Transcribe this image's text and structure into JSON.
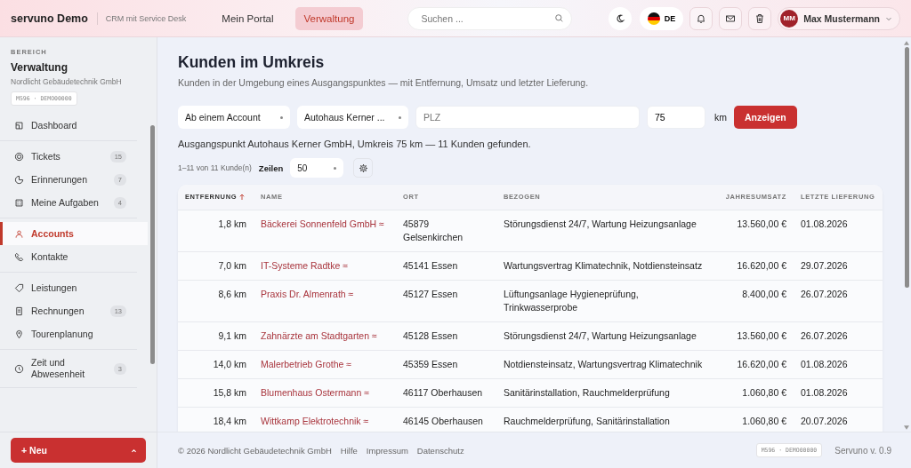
{
  "header": {
    "brand": "servuno Demo",
    "tagline": "CRM mit Service Desk",
    "nav": [
      {
        "label": "Mein Portal",
        "selected": false
      },
      {
        "label": "Verwaltung",
        "selected": true
      }
    ],
    "search": {
      "placeholder": "Suchen ..."
    },
    "language": "DE",
    "user": {
      "initials": "MM",
      "name": "Max Mustermann"
    }
  },
  "sidebar": {
    "section_label": "BEREICH",
    "title": "Verwaltung",
    "company": "Nordlicht Gebäudetechnik GmbH",
    "code": "M596 · DEMO00000",
    "groups": [
      {
        "items": [
          {
            "label": "Dashboard",
            "selected": false
          }
        ]
      },
      {
        "items": [
          {
            "label": "Tickets",
            "count": "15",
            "selected": false
          },
          {
            "label": "Erinnerungen",
            "count": "7",
            "selected": false
          },
          {
            "label": "Meine Aufgaben",
            "count": "4",
            "selected": false
          }
        ]
      },
      {
        "items": [
          {
            "label": "Accounts",
            "selected": true
          },
          {
            "label": "Kontakte",
            "selected": false
          }
        ]
      },
      {
        "items": [
          {
            "label": "Leistungen",
            "selected": false
          },
          {
            "label": "Rechnungen",
            "count": "13",
            "selected": false
          },
          {
            "label": "Tourenplanung",
            "selected": false
          }
        ]
      },
      {
        "items": [
          {
            "label": "Zeit und Abwesenheit",
            "count": "3",
            "selected": false
          }
        ]
      }
    ],
    "new_button": "+ Neu"
  },
  "page": {
    "title": "Kunden im Umkreis",
    "subtitle": "Kunden in der Umgebung eines Ausgangspunktes — mit Entfernung, Umsatz und letzter Lieferung.",
    "filters": {
      "mode": "Ab einem Account",
      "account": "Autohaus Kerner ...",
      "plz_placeholder": "PLZ",
      "radius": "75",
      "unit": "km",
      "button": "Anzeigen"
    },
    "result": "Ausgangspunkt Autohaus Kerner GmbH, Umkreis 75 km — 11 Kunden gefunden.",
    "pagination": {
      "range": "1–11 von 11 Kunde(n)",
      "rows_label": "Zeilen",
      "rows_value": "50"
    },
    "table": {
      "columns": [
        {
          "label": "ENTFERNUNG",
          "sorted": true
        },
        {
          "label": "NAME",
          "sorted": false
        },
        {
          "label": "ORT",
          "sorted": false
        },
        {
          "label": "BEZOGEN",
          "sorted": false
        },
        {
          "label": "JAHRESUMSATZ",
          "sorted": false
        },
        {
          "label": "LETZTE LIEFERUNG",
          "sorted": false
        }
      ],
      "rows": [
        {
          "distance": "1,8 km",
          "name": "Bäckerei Sonnenfeld GmbH ≈",
          "city": "45879 Gelsenkirchen",
          "services": "Störungsdienst 24/7, Wartung Heizungsanlage",
          "revenue": "13.560,00 €",
          "last_delivery": "01.08.2026"
        },
        {
          "distance": "7,0 km",
          "name": "IT-Systeme Radtke ≈",
          "city": "45141 Essen",
          "services": "Wartungsvertrag Klimatechnik, Notdiensteinsatz",
          "revenue": "16.620,00 €",
          "last_delivery": "29.07.2026"
        },
        {
          "distance": "8,6 km",
          "name": "Praxis Dr. Almenrath ≈",
          "city": "45127 Essen",
          "services": "Lüftungsanlage Hygieneprüfung, Trinkwasserprobe",
          "revenue": "8.400,00 €",
          "last_delivery": "26.07.2026"
        },
        {
          "distance": "9,1 km",
          "name": "Zahnärzte am Stadtgarten ≈",
          "city": "45128 Essen",
          "services": "Störungsdienst 24/7, Wartung Heizungsanlage",
          "revenue": "13.560,00 €",
          "last_delivery": "26.07.2026"
        },
        {
          "distance": "14,0 km",
          "name": "Malerbetrieb Grothe ≈",
          "city": "45359 Essen",
          "services": "Notdiensteinsatz, Wartungsvertrag Klimatechnik",
          "revenue": "16.620,00 €",
          "last_delivery": "01.08.2026"
        },
        {
          "distance": "15,8 km",
          "name": "Blumenhaus Ostermann ≈",
          "city": "46117 Oberhausen",
          "services": "Sanitärinstallation, Rauchmelderprüfung",
          "revenue": "1.060,80 €",
          "last_delivery": "01.08.2026"
        },
        {
          "distance": "18,4 km",
          "name": "Wittkamp Elektrotechnik ≈",
          "city": "46145 Oberhausen",
          "services": "Rauchmelderprüfung, Sanitärinstallation",
          "revenue": "1.060,80 €",
          "last_delivery": "20.07.2026"
        }
      ]
    }
  },
  "footer": {
    "copyright": "© 2026 Nordlicht Gebäudetechnik GmbH",
    "links": [
      "Hilfe",
      "Impressum",
      "Datenschutz"
    ],
    "code": "M596 · DEMO00000",
    "version": "Servuno v. 0.9"
  }
}
